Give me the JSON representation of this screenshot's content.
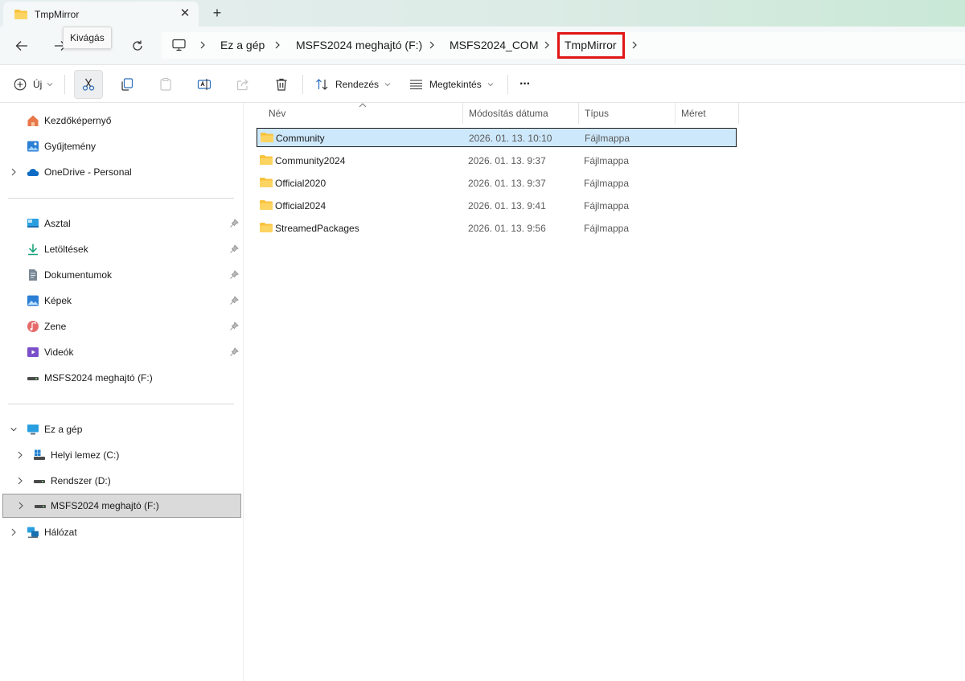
{
  "window": {
    "tab_title": "TmpMirror",
    "tab_close": "✕",
    "new_tab": "+"
  },
  "nav": {
    "tooltip": "Kivágás"
  },
  "breadcrumb": {
    "items": [
      "Ez a gép",
      "MSFS2024 meghajtó (F:)",
      "MSFS2024_COM",
      "TmpMirror"
    ],
    "highlighted_item": "TmpMirror",
    "highlight_color": "#e01515"
  },
  "toolbar": {
    "new_label": "Új",
    "sort_label": "Rendezés",
    "view_label": "Megtekintés",
    "more_label": "···"
  },
  "sidebar": {
    "top": [
      {
        "label": "Kezdőképernyő",
        "icon": "home-icon"
      },
      {
        "label": "Gyűjtemény",
        "icon": "gallery-icon"
      },
      {
        "label": "OneDrive - Personal",
        "icon": "cloud-icon"
      }
    ],
    "quick_access": [
      {
        "label": "Asztal",
        "icon": "desktop-icon"
      },
      {
        "label": "Letöltések",
        "icon": "download-icon"
      },
      {
        "label": "Dokumentumok",
        "icon": "document-icon"
      },
      {
        "label": "Képek",
        "icon": "pictures-icon"
      },
      {
        "label": "Zene",
        "icon": "music-icon"
      },
      {
        "label": "Videók",
        "icon": "video-icon"
      },
      {
        "label": "MSFS2024 meghajtó (F:)",
        "icon": "drive-icon"
      }
    ],
    "this_pc": {
      "label": "Ez a gép",
      "icon": "computer-icon"
    },
    "drives": [
      {
        "label": "Helyi lemez (C:)",
        "icon": "windows-drive-icon"
      },
      {
        "label": "Rendszer (D:)",
        "icon": "drive-icon"
      },
      {
        "label": "MSFS2024 meghajtó (F:)",
        "icon": "drive-icon"
      }
    ],
    "network": {
      "label": "Hálózat",
      "icon": "network-icon"
    }
  },
  "filelist": {
    "columns": [
      "Név",
      "Módosítás dátuma",
      "Típus",
      "Méret"
    ],
    "rows": [
      {
        "name": "Community",
        "date": "2026. 01. 13. 10:10",
        "type": "Fájlmappa",
        "size": ""
      },
      {
        "name": "Community2024",
        "date": "2026. 01. 13. 9:37",
        "type": "Fájlmappa",
        "size": ""
      },
      {
        "name": "Official2020",
        "date": "2026. 01. 13. 9:37",
        "type": "Fájlmappa",
        "size": ""
      },
      {
        "name": "Official2024",
        "date": "2026. 01. 13. 9:41",
        "type": "Fájlmappa",
        "size": ""
      },
      {
        "name": "StreamedPackages",
        "date": "2026. 01. 13. 9:56",
        "type": "Fájlmappa",
        "size": ""
      }
    ],
    "selected_row": "Community",
    "selection_color": "#cde8fb"
  },
  "colors": {
    "folder": "#f8c23a",
    "accent": "#0067c0"
  }
}
